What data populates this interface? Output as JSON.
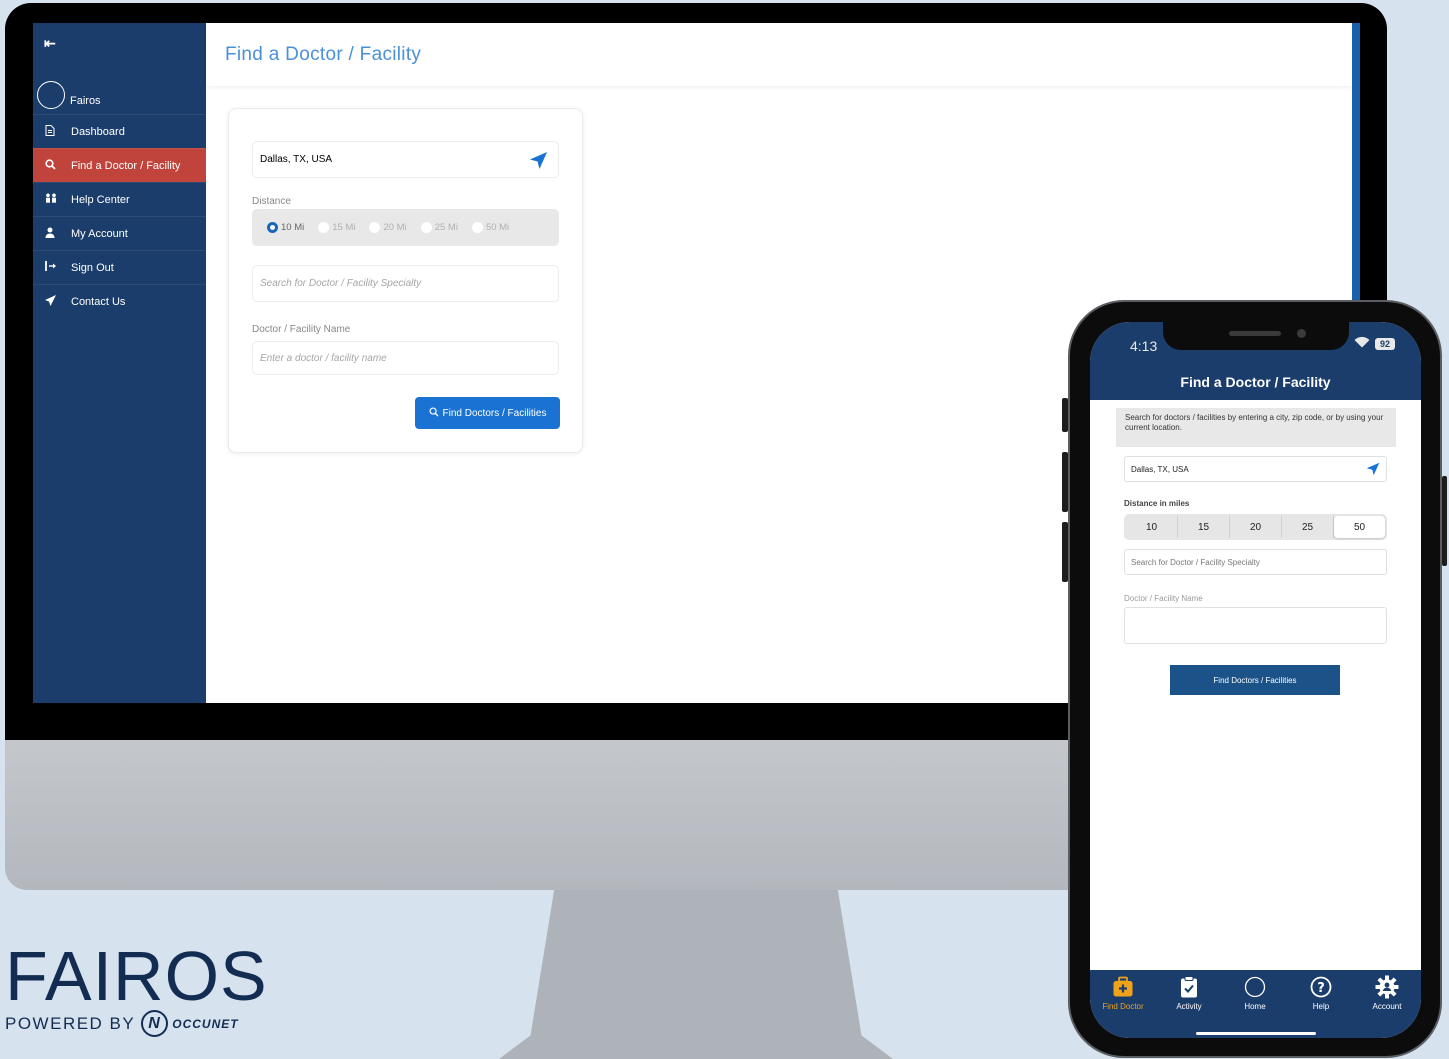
{
  "desktop": {
    "sidebar": {
      "collapse_icon": "collapse-sidebar-icon",
      "brand": "Fairos",
      "items": [
        {
          "label": "Dashboard",
          "icon": "document-icon"
        },
        {
          "label": "Find a Doctor / Facility",
          "icon": "search-icon",
          "active": true
        },
        {
          "label": "Help Center",
          "icon": "users-icon"
        },
        {
          "label": "My Account",
          "icon": "user-icon"
        },
        {
          "label": "Sign Out",
          "icon": "sign-out-icon"
        },
        {
          "label": "Contact Us",
          "icon": "send-icon"
        }
      ]
    },
    "header": {
      "title": "Find a Doctor / Facility"
    },
    "search_form": {
      "location_value": "Dallas, TX, USA",
      "distance_label": "Distance",
      "distance_options": [
        "10 Mi",
        "15 Mi",
        "20 Mi",
        "25 Mi",
        "50 Mi"
      ],
      "distance_selected": "10 Mi",
      "specialty_placeholder": "Search for Doctor / Facility Specialty",
      "name_label": "Doctor / Facility Name",
      "name_placeholder": "Enter a doctor / facility name",
      "submit_label": "Find Doctors / Facilities"
    }
  },
  "mobile": {
    "status": {
      "time": "4:13",
      "battery": "92"
    },
    "title": "Find a Doctor / Facility",
    "intro": "Search for doctors / facilities by entering a city, zip code, or by using your current location.",
    "location_value": "Dallas, TX, USA",
    "distance_label": "Distance in miles",
    "distance_options": [
      "10",
      "15",
      "20",
      "25",
      "50"
    ],
    "distance_selected": "50",
    "specialty_placeholder": "Search for Doctor / Facility Specialty",
    "name_label": "Doctor / Facility Name",
    "submit_label": "Find Doctors / Facilities",
    "tabs": [
      {
        "label": "Find Doctor",
        "icon": "medical-bag-icon",
        "active": true
      },
      {
        "label": "Activity",
        "icon": "clipboard-icon"
      },
      {
        "label": "Home",
        "icon": "home-circle-icon"
      },
      {
        "label": "Help",
        "icon": "help-icon"
      },
      {
        "label": "Account",
        "icon": "settings-gear-icon"
      }
    ]
  },
  "logo": {
    "wordmark": "FAIROS",
    "tagline": "POWERED BY",
    "partner": "OCCUNET"
  },
  "colors": {
    "navy": "#1b3d6b",
    "active_red": "#c0443c",
    "primary_blue": "#1a72d2",
    "title_blue": "#4a90d9",
    "tab_active": "#f0a21b"
  }
}
